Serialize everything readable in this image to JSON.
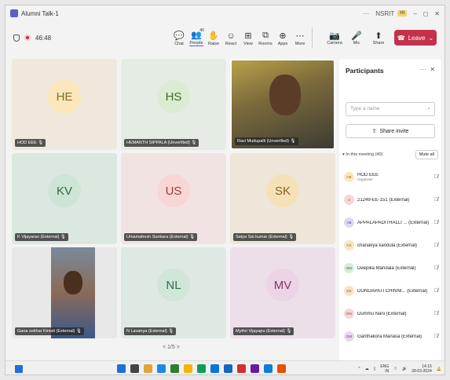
{
  "window": {
    "title": "Alumni Talk-1",
    "tenant": "NSRIT",
    "tenant_badge": "HI"
  },
  "toolbar": {
    "timer": "46:48",
    "tools": [
      {
        "icon": "chat-icon",
        "glyph": "💬",
        "label": "Chat",
        "active": false
      },
      {
        "icon": "people-icon",
        "glyph": "👥",
        "label": "People",
        "badge": "40",
        "active": true
      },
      {
        "icon": "raise-hand-icon",
        "glyph": "✋",
        "label": "Raise",
        "active": false
      },
      {
        "icon": "react-icon",
        "glyph": "☺",
        "label": "React",
        "active": false
      },
      {
        "icon": "view-icon",
        "glyph": "⊞",
        "label": "View",
        "active": false
      },
      {
        "icon": "rooms-icon",
        "glyph": "⧉",
        "label": "Rooms",
        "active": false
      },
      {
        "icon": "apps-icon",
        "glyph": "⊕",
        "label": "Apps",
        "active": false
      },
      {
        "icon": "more-icon",
        "glyph": "⋯",
        "label": "More",
        "active": false
      }
    ],
    "devices": [
      {
        "icon": "camera-icon",
        "glyph": "📷",
        "label": "Camera"
      },
      {
        "icon": "mic-icon",
        "glyph": "🎤",
        "label": "Mic"
      },
      {
        "icon": "share-icon",
        "glyph": "⬆",
        "label": "Share"
      }
    ],
    "leave_label": "Leave"
  },
  "tiles": [
    {
      "initials": "HE",
      "name": "HOD EEE",
      "bg": "#efe9dd",
      "avatar_bg": "#fbe7b9",
      "avatar_fg": "#8a6a1f",
      "video": false
    },
    {
      "initials": "HS",
      "name": "HEMANTH SIPPALA (Unverified)",
      "bg": "#e4ece4",
      "avatar_bg": "#dcecd2",
      "avatar_fg": "#3b6b2a",
      "video": false
    },
    {
      "initials": "",
      "name": "Ravi Mudupalli (Unverified)",
      "bg": "#6d6a4f",
      "video": true
    },
    {
      "initials": "KV",
      "name": "K Vijayarao (External)",
      "bg": "#dbe8df",
      "avatar_bg": "#cde5d4",
      "avatar_fg": "#2f6b46",
      "video": false
    },
    {
      "initials": "US",
      "name": "Umamahesh Sunkara (External)",
      "bg": "#f2e3e3",
      "avatar_bg": "#f8d6d6",
      "avatar_fg": "#9a3b3b",
      "video": false
    },
    {
      "initials": "SK",
      "name": "Satya Sai kumar (External)",
      "bg": "#eee6d8",
      "avatar_bg": "#f5e1b7",
      "avatar_fg": "#8a621a",
      "video": false
    },
    {
      "initials": "",
      "name": "Gana sekhar Kintali (External)",
      "bg": "#e8e8e8",
      "video": true
    },
    {
      "initials": "NL",
      "name": "N Lavanya (External)",
      "bg": "#dfe9e3",
      "avatar_bg": "#cfe6d8",
      "avatar_fg": "#2f6b4a",
      "video": false
    },
    {
      "initials": "MV",
      "name": "Mythri Vijayapu (External)",
      "bg": "#ecdfea",
      "avatar_bg": "#ecd3e6",
      "avatar_fg": "#7a3b6a",
      "video": false
    }
  ],
  "pager": "< 1/5 >",
  "participants": {
    "header": "Participants",
    "search_placeholder": "Type a name",
    "share_invite": "Share invite",
    "in_meeting": "In this meeting (40)",
    "mute_all": "Mute all",
    "list": [
      {
        "initials": "HE",
        "name": "HOD EEE",
        "role": "Organiser",
        "bg": "#fbe7b9",
        "fg": "#8a6a1f"
      },
      {
        "initials": "2",
        "name": "21249-EE-151 (External)",
        "role": "",
        "bg": "#f6d6d6",
        "fg": "#9a3b3b"
      },
      {
        "initials": "AB",
        "name": "APPALAPADITHALLI ... (External)",
        "role": "",
        "bg": "#dcd9f3",
        "fg": "#4a3f9a"
      },
      {
        "initials": "CK",
        "name": "chanakya kandula (External)",
        "role": "",
        "bg": "#f5e6c2",
        "fg": "#8a621a"
      },
      {
        "initials": "DM",
        "name": "Deepika Mandala (External)",
        "role": "",
        "bg": "#d5ecd9",
        "fg": "#2f6b46"
      },
      {
        "initials": "DK",
        "name": "DONDAPATI CHINNI... (External)",
        "role": "",
        "bg": "#f7e2c8",
        "fg": "#8a4f1a"
      },
      {
        "initials": "DN",
        "name": "Dummu Nani (External)",
        "role": "",
        "bg": "#f5d7d7",
        "fg": "#9a3b3b"
      },
      {
        "initials": "GM",
        "name": "Ganthakora Manasa (External)",
        "role": "",
        "bg": "#e8d6ee",
        "fg": "#6a3b7a"
      }
    ]
  },
  "taskbar": {
    "lang": "ENG",
    "lang2": "IN",
    "time": "14:15",
    "date": "28-03-2024",
    "apps": [
      "#1e6fd9",
      "#444",
      "#e1a33a",
      "#1e88e5",
      "#2e7d32",
      "#f4b400",
      "#0f9d58",
      "#0078d4",
      "#1565c0",
      "#d32f2f",
      "#6a1b9a",
      "#0f7dd6",
      "#e65100"
    ]
  }
}
